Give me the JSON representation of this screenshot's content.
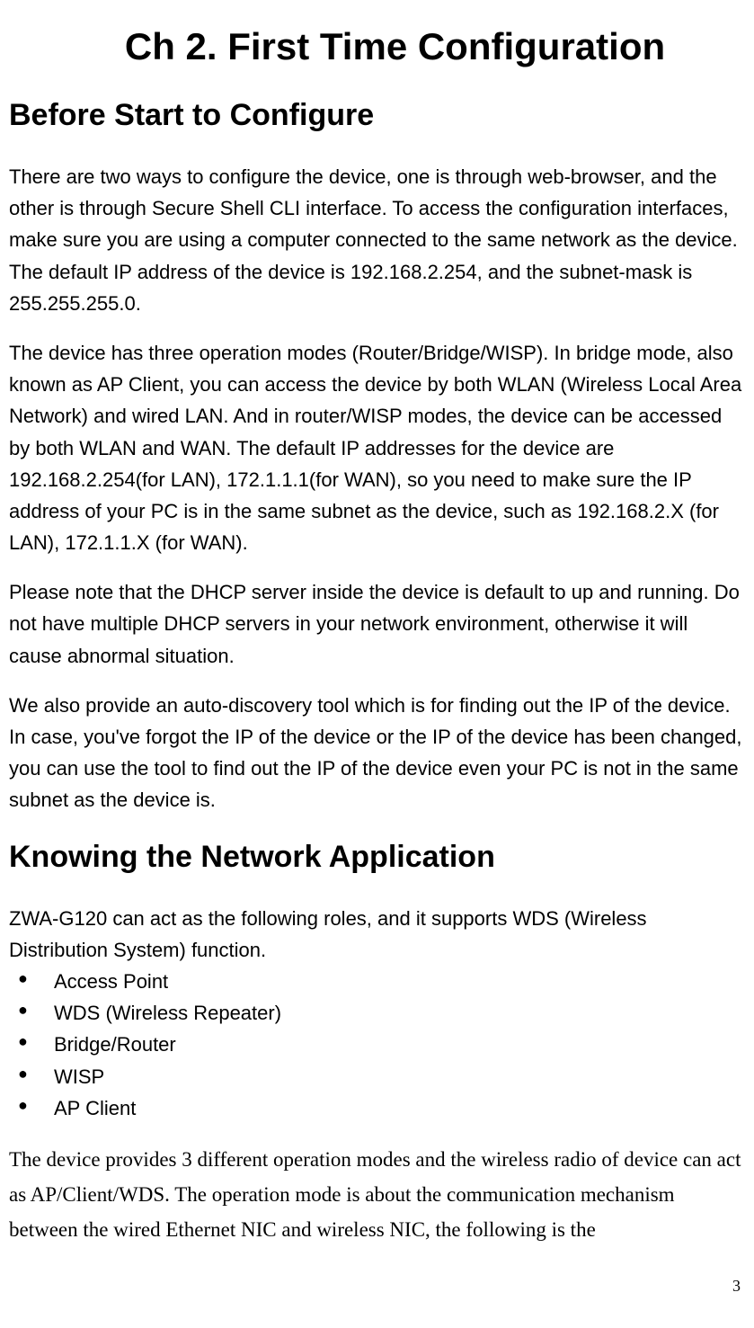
{
  "chapter_title": "Ch 2. First Time Configuration",
  "sections": {
    "before_start": {
      "title": "Before Start to Configure",
      "paragraphs": [
        "There are two ways to configure the device, one is through web-browser, and the other is through Secure Shell CLI interface. To access the configuration interfaces, make sure you are using a computer connected to the same network as the device. The default IP address of the device is 192.168.2.254, and the subnet-mask is 255.255.255.0.",
        "The device has three operation modes (Router/Bridge/WISP). In bridge mode, also known as AP Client, you can access the device by both WLAN (Wireless Local Area Network) and wired LAN. And in router/WISP modes, the device can be accessed by both WLAN and WAN. The default IP addresses for the device are 192.168.2.254(for LAN), 172.1.1.1(for WAN), so you need to make sure the IP address of your PC is in the same subnet as the device, such as 192.168.2.X (for LAN), 172.1.1.X (for WAN).",
        "Please note that the DHCP server inside the device is default to up and running. Do not have multiple DHCP servers in your network environment, otherwise it will cause abnormal situation.",
        "We also provide an auto-discovery tool which is for finding out the IP of the device. In case, you've forgot the IP of the device or the IP of the device has been changed, you can use the tool to find out the IP of the device even your PC is not in the same subnet as the device is."
      ]
    },
    "knowing_network": {
      "title": "Knowing the Network Application",
      "intro": "ZWA-G120 can act as the following roles, and it supports WDS (Wireless Distribution System) function.",
      "bullets": [
        "Access Point",
        "WDS (Wireless Repeater)",
        "Bridge/Router",
        "WISP",
        "AP Client"
      ],
      "closing": "The device provides 3 different operation modes and the wireless radio of device can act as AP/Client/WDS. The operation mode is about the communication mechanism between the wired Ethernet NIC and wireless NIC, the following is the"
    }
  },
  "page_number": "3"
}
